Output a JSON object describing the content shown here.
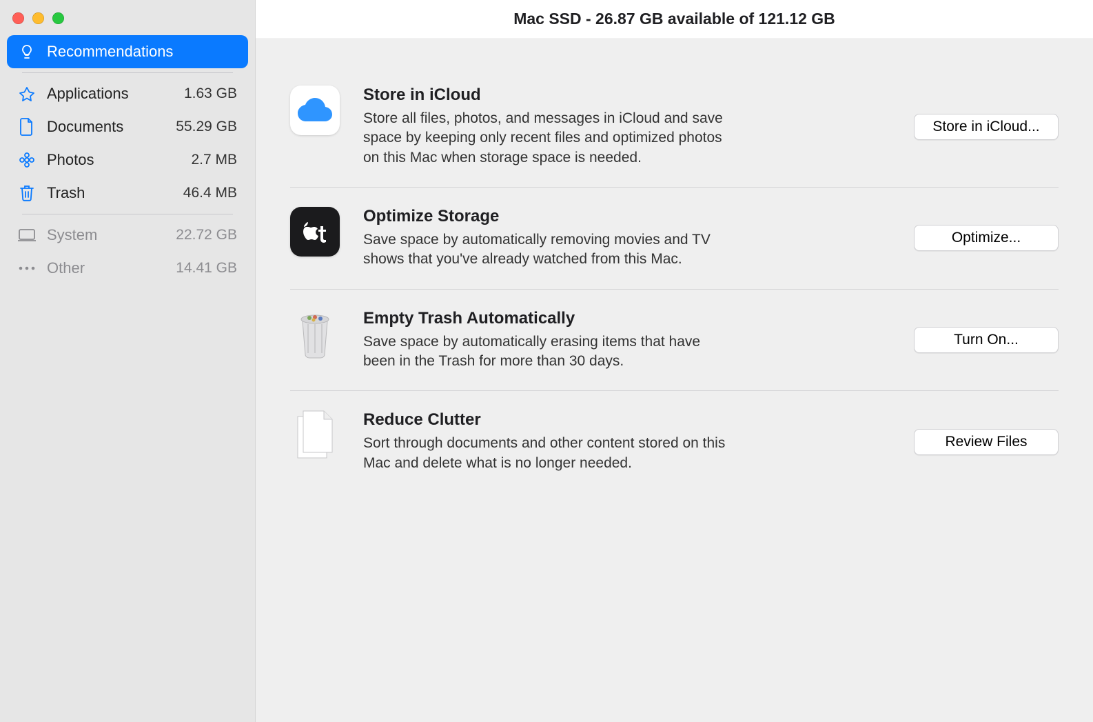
{
  "window_title": "Mac SSD - 26.87 GB available of 121.12 GB",
  "sidebar": {
    "items": [
      {
        "label": "Recommendations",
        "size": ""
      },
      {
        "label": "Applications",
        "size": "1.63 GB"
      },
      {
        "label": "Documents",
        "size": "55.29 GB"
      },
      {
        "label": "Photos",
        "size": "2.7 MB"
      },
      {
        "label": "Trash",
        "size": "46.4 MB"
      },
      {
        "label": "System",
        "size": "22.72 GB"
      },
      {
        "label": "Other",
        "size": "14.41 GB"
      }
    ]
  },
  "recs": [
    {
      "title": "Store in iCloud",
      "desc": "Store all files, photos, and messages in iCloud and save space by keeping only recent files and optimized photos on this Mac when storage space is needed.",
      "button": "Store in iCloud..."
    },
    {
      "title": "Optimize Storage",
      "desc": "Save space by automatically removing movies and TV shows that you've already watched from this Mac.",
      "button": "Optimize..."
    },
    {
      "title": "Empty Trash Automatically",
      "desc": "Save space by automatically erasing items that have been in the Trash for more than 30 days.",
      "button": "Turn On..."
    },
    {
      "title": "Reduce Clutter",
      "desc": "Sort through documents and other content stored on this Mac and delete what is no longer needed.",
      "button": "Review Files"
    }
  ]
}
